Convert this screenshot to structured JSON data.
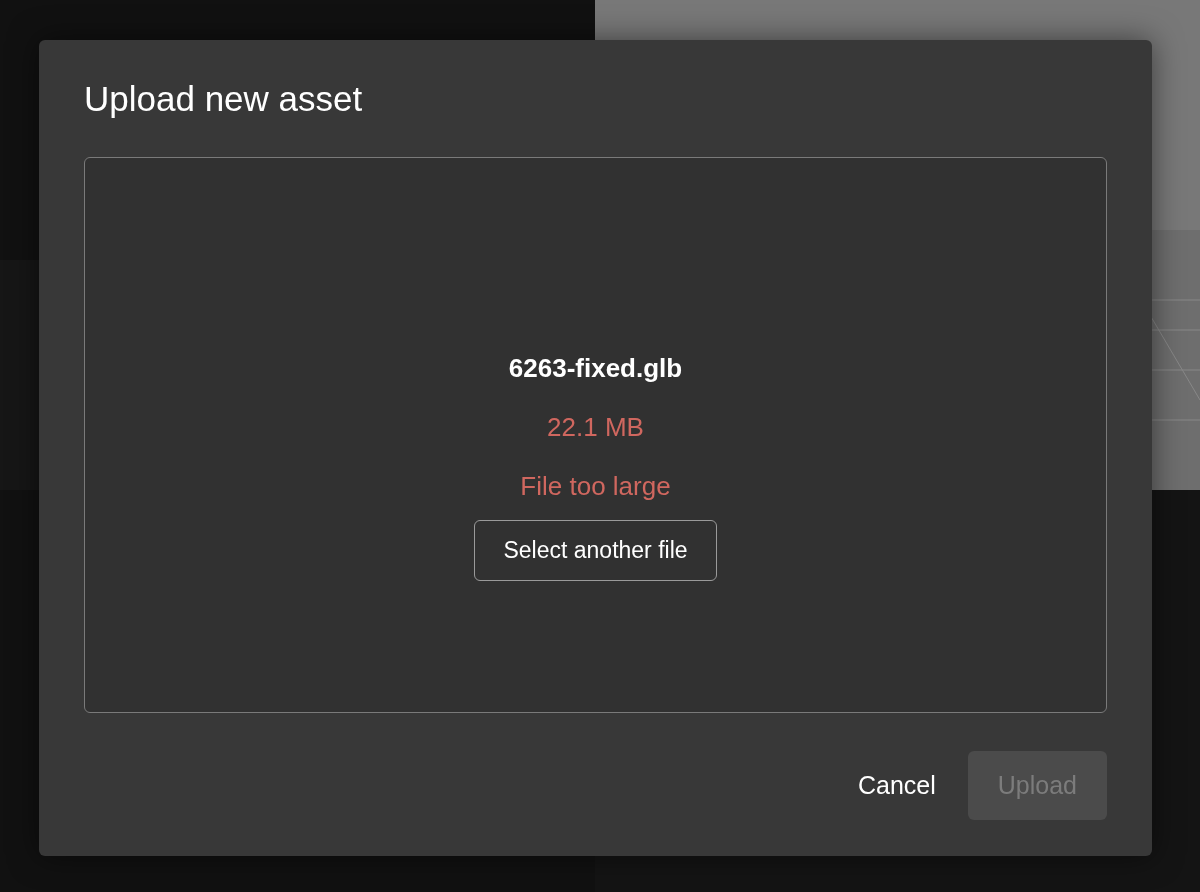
{
  "dialog": {
    "title": "Upload new asset"
  },
  "file": {
    "name": "6263-fixed.glb",
    "size": "22.1 MB",
    "too_large": true,
    "error": "File too large"
  },
  "drop_zone": {
    "button": "Select another file"
  },
  "buttons": [
    {
      "label": "Cancel",
      "kind": "text",
      "disabled": false
    },
    {
      "label": "Upload",
      "kind": "filled",
      "disabled": true
    }
  ]
}
